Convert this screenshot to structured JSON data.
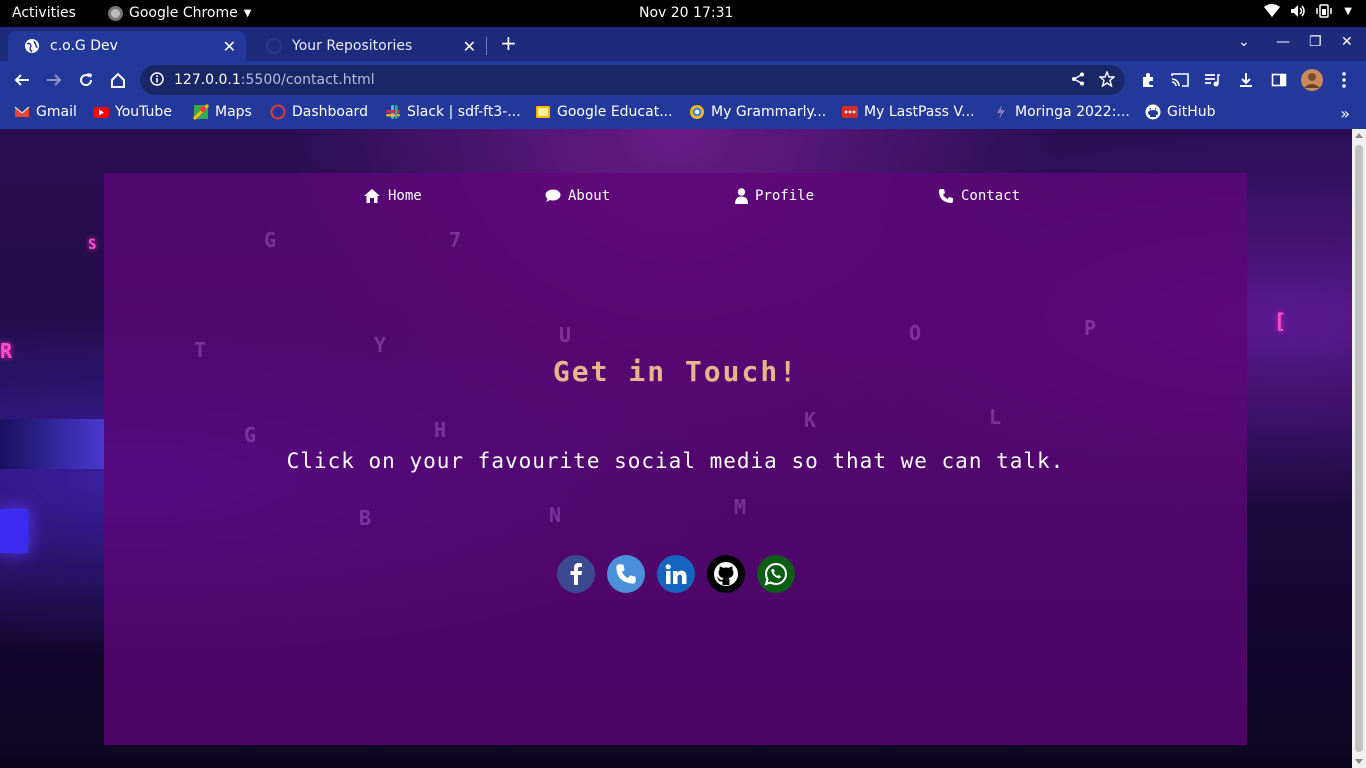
{
  "system": {
    "activities": "Activities",
    "app_name": "Google Chrome",
    "clock": "Nov 20  17:31"
  },
  "tabs": [
    {
      "title": "c.o.G Dev",
      "active": true
    },
    {
      "title": "Your Repositories",
      "active": false
    }
  ],
  "address": {
    "host": "127.0.0.1",
    "path": ":5500/contact.html"
  },
  "bookmarks": [
    {
      "label": "Gmail",
      "icon": "gmail-icon",
      "color": "#ea4335"
    },
    {
      "label": "YouTube",
      "icon": "youtube-icon",
      "color": "#ff0000"
    },
    {
      "label": "Maps",
      "icon": "maps-icon",
      "color": "#34a853"
    },
    {
      "label": "Dashboard",
      "icon": "dashboard-icon",
      "color": "#e53935"
    },
    {
      "label": "Slack | sdf-ft3-...",
      "icon": "slack-icon",
      "color": "#e01e5a"
    },
    {
      "label": "Google Educat...",
      "icon": "google-education-icon",
      "color": "#f4b400"
    },
    {
      "label": "My Grammarly...",
      "icon": "grammarly-icon",
      "color": "#15c39a"
    },
    {
      "label": "My LastPass V...",
      "icon": "lastpass-icon",
      "color": "#d32d27"
    },
    {
      "label": "Moringa 2022:...",
      "icon": "moringa-icon",
      "color": "#8e7cc3"
    },
    {
      "label": "GitHub",
      "icon": "github-icon",
      "color": "#ffffff"
    }
  ],
  "nav": [
    {
      "label": "Home",
      "icon": "home-icon"
    },
    {
      "label": "About",
      "icon": "comment-icon"
    },
    {
      "label": "Profile",
      "icon": "user-icon"
    },
    {
      "label": "Contact",
      "icon": "phone-icon"
    }
  ],
  "content": {
    "title": "Get in Touch!",
    "subtitle": "Click on your favourite social media so that we can talk."
  },
  "socials": [
    {
      "name": "facebook",
      "icon": "facebook-icon",
      "color": "#3b4a8f"
    },
    {
      "name": "phone",
      "icon": "phone-icon",
      "color": "#4a90d9"
    },
    {
      "name": "linkedin",
      "icon": "linkedin-icon",
      "color": "#1565c0"
    },
    {
      "name": "github",
      "icon": "github-icon",
      "color": "#000000"
    },
    {
      "name": "whatsapp",
      "icon": "whatsapp-icon",
      "color": "#0d5e14"
    }
  ],
  "colors": {
    "tabstrip": "#1e2a7c",
    "toolbar": "#23399a",
    "panel": "#5f0578",
    "title": "#e8b48a"
  }
}
